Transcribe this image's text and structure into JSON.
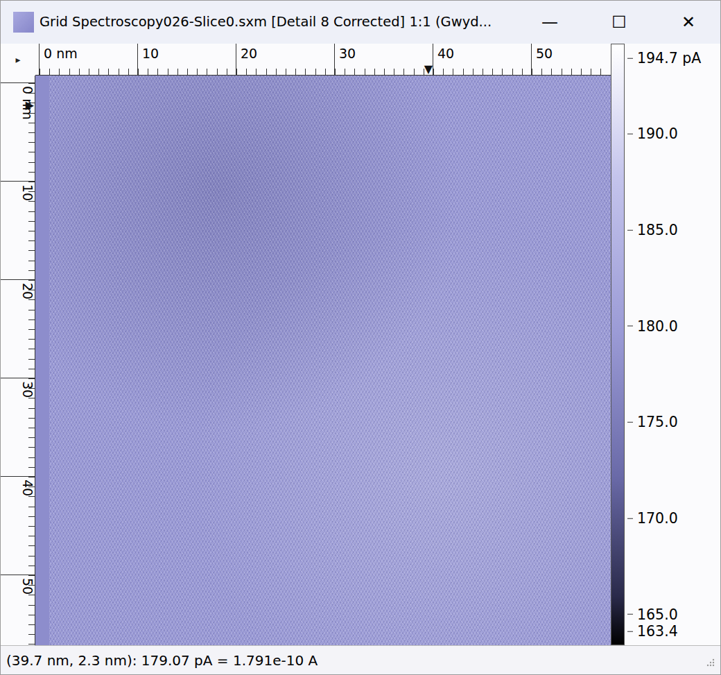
{
  "window": {
    "title": "Grid Spectroscopy026-Slice0.sxm [Detail 8 Corrected] 1:1 (Gwyd...",
    "controls": [
      "—",
      "☐",
      "✕"
    ]
  },
  "ruler_corner": "▸",
  "top_ruler": {
    "labels": [
      "0 nm",
      "10",
      "20",
      "30",
      "40",
      "50"
    ],
    "marker": "▼"
  },
  "left_ruler": {
    "labels": [
      "0 nm",
      "10",
      "20",
      "30",
      "40",
      "50"
    ],
    "marker": "▶"
  },
  "cursor": {
    "x_nm": 39.7,
    "y_nm": 2.3
  },
  "colorbar": {
    "labels": [
      "194.7 pA",
      "190.0",
      "185.0",
      "180.0",
      "175.0",
      "170.0",
      "165.0",
      "163.4"
    ]
  },
  "status_bar": "(39.7 nm, 2.3 nm): 179.07 pA = 1.791e-10 A"
}
